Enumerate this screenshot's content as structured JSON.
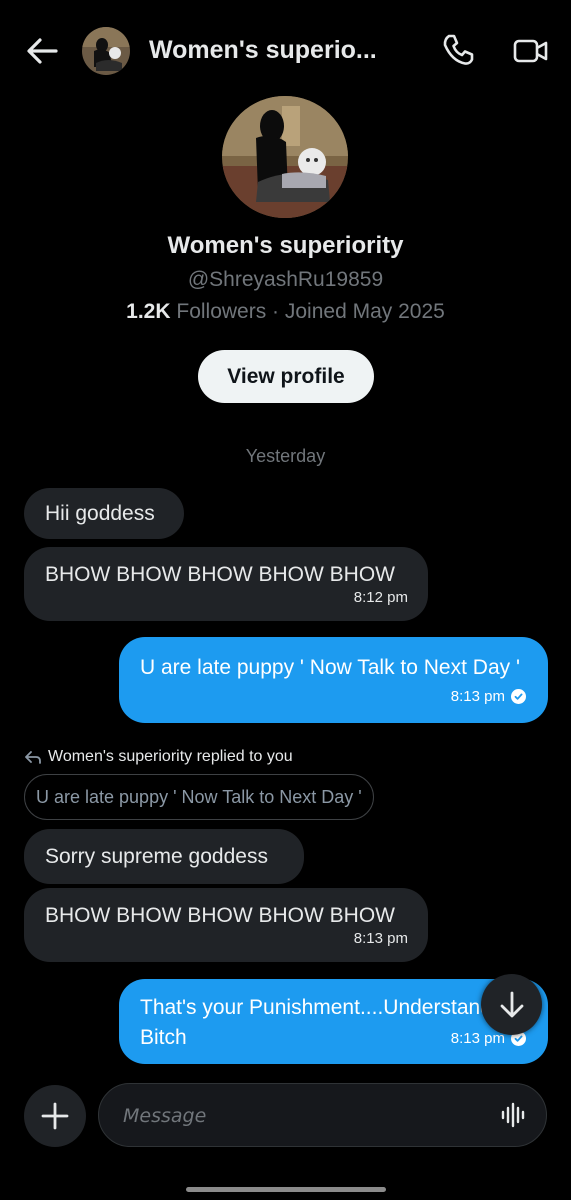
{
  "header": {
    "title": "Women's superio...",
    "back_icon": "arrow-left-icon",
    "call_icon": "phone-icon",
    "video_icon": "video-camera-icon"
  },
  "profile": {
    "name": "Women's superiority",
    "handle": "@ShreyashRu19859",
    "followers_count": "1.2K",
    "followers_rest": " Followers · Joined May 2025",
    "view_profile_label": "View profile"
  },
  "conversation": {
    "date_separator": "Yesterday",
    "messages": [
      {
        "dir": "in",
        "text": "Hii goddess"
      },
      {
        "dir": "in",
        "text": "BHOW BHOW BHOW BHOW BHOW",
        "time": "8:12 pm"
      },
      {
        "dir": "out",
        "text": "U are late puppy ' Now Talk to Next Day '",
        "time": "8:13 pm"
      },
      {
        "dir": "in",
        "text": "Sorry supreme goddess"
      },
      {
        "dir": "in",
        "text": "BHOW BHOW BHOW BHOW BHOW",
        "time": "8:13 pm"
      },
      {
        "dir": "out",
        "text": "That's your Punishment....Understand Bitch",
        "time": "8:13 pm"
      }
    ],
    "reply_context": {
      "label": "Women's superiority replied to you",
      "quoted_text": "U are late puppy ' Now Talk to Next Day '"
    }
  },
  "composer": {
    "placeholder": "Message",
    "add_icon": "plus-icon",
    "voice_icon": "voice-wave-icon"
  },
  "colors": {
    "background": "#000000",
    "incoming_bubble": "#202327",
    "outgoing_bubble": "#1d9bf0",
    "muted_text": "#71767b"
  }
}
